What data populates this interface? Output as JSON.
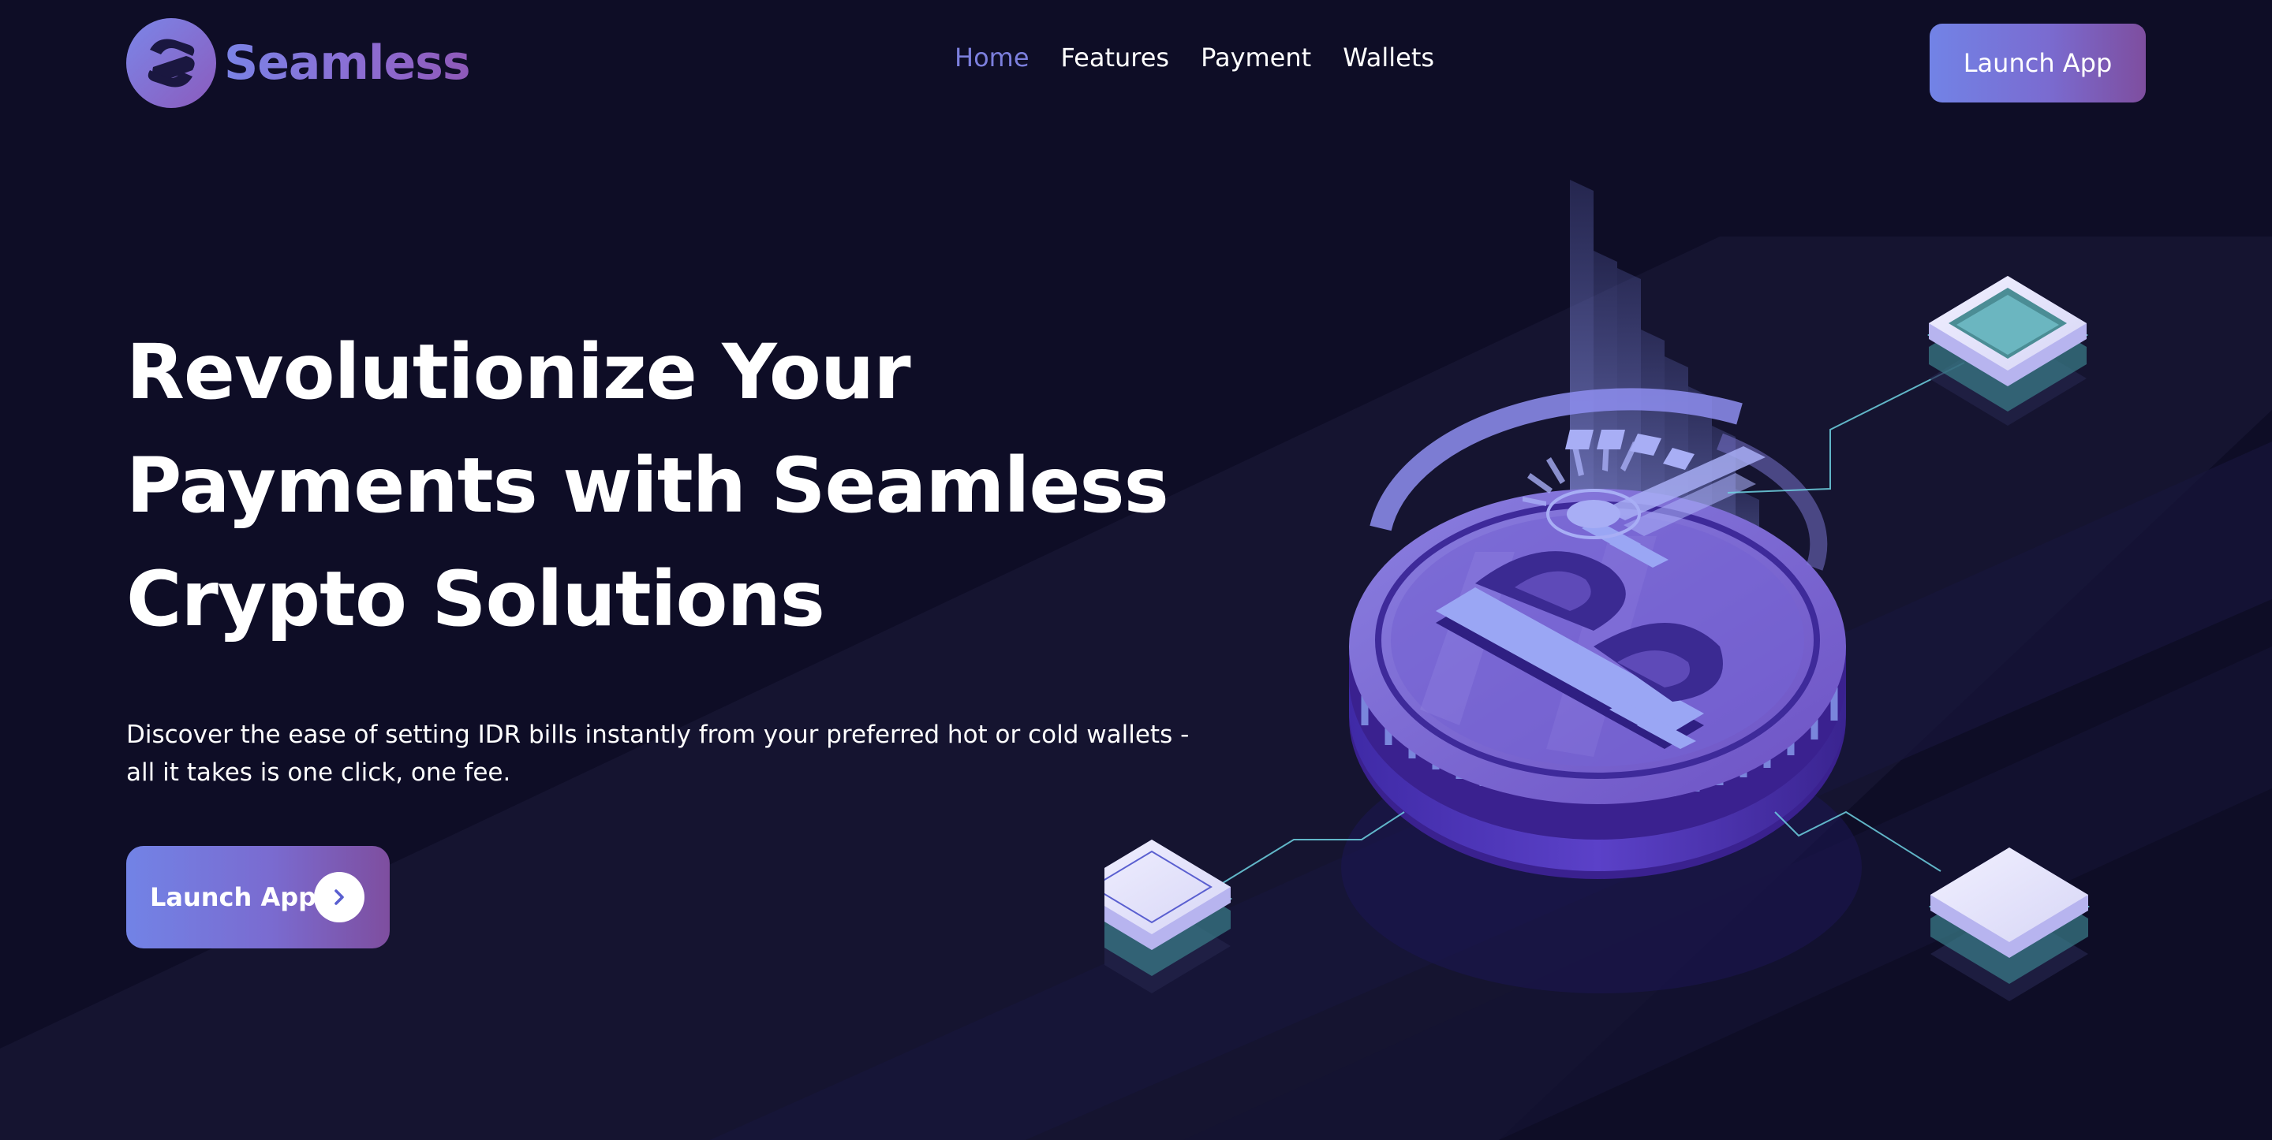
{
  "brand": {
    "name": "Seamless",
    "logo_icon": "s-swirl-logo-icon",
    "accent_start": "#7283e6",
    "accent_end": "#7e4e9f",
    "background": "#0e0d26"
  },
  "nav": {
    "links": [
      {
        "label": "Home",
        "active": true
      },
      {
        "label": "Features",
        "active": false
      },
      {
        "label": "Payment",
        "active": false
      },
      {
        "label": "Wallets",
        "active": false
      }
    ],
    "cta_label": "Launch App"
  },
  "hero": {
    "title_lines": [
      "Revolutionize Your",
      "Payments with Seamless",
      "Crypto Solutions"
    ],
    "description_lines": [
      "Discover the ease of setting IDR bills instantly from your preferred hot or cold wallets -",
      "all it takes is one click, one fee."
    ],
    "cta_label": "Launch App",
    "cta_icon": "chevron-right-icon"
  },
  "illustration": {
    "subject": "isometric-bitcoin-coin-illustration",
    "icons": [
      "bitcoin-icon",
      "wallet-tile-icon"
    ]
  }
}
